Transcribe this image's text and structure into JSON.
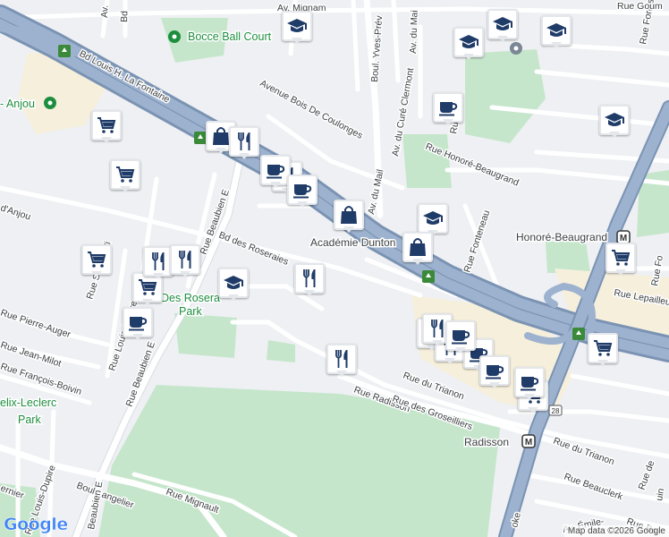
{
  "labels": {
    "roads": [
      {
        "id": "bd-louis-h-la-fontaine",
        "text": "Bd Louis H. La Fontaine"
      },
      {
        "id": "boul-yves-prevost",
        "text": "Boul. Yves-Prév"
      },
      {
        "id": "av-du-mail-1",
        "text": "Av. du Mail"
      },
      {
        "id": "av-du-mail-2",
        "text": "Av. du Mail"
      },
      {
        "id": "av-du-cure-clermont",
        "text": "Av. du Curé Clermont"
      },
      {
        "id": "avenue-bois-de-coulonges",
        "text": "Avenue Bois De Coulonges"
      },
      {
        "id": "bd-anjou",
        "text": "d'Anjou"
      },
      {
        "id": "rue-beaubien-e-1",
        "text": "Rue Beaubien E"
      },
      {
        "id": "rue-beaubien-e-2",
        "text": "Rue Beaubien E"
      },
      {
        "id": "bd-des-roseraies",
        "text": "Bd des Roseraies"
      },
      {
        "id": "rue-saint-zotique",
        "text": "Rue Saint-Zoti"
      },
      {
        "id": "rue-pierre-auger",
        "text": "Rue Pierre-Auger"
      },
      {
        "id": "rue-jean-milot",
        "text": "Rue Jean-Milot"
      },
      {
        "id": "rue-francois-boivin",
        "text": "Rue François-Boivin"
      },
      {
        "id": "rue-louis-dupire-1",
        "text": "Rue Louis-Dupire"
      },
      {
        "id": "rue-louis-dupire-2",
        "text": "Rue Louis-Dupire"
      },
      {
        "id": "boul-langelier",
        "text": "Boul Langelier"
      },
      {
        "id": "rue-mignault",
        "text": "Rue Mignault"
      },
      {
        "id": "rue-radisson",
        "text": "Rue Radisson"
      },
      {
        "id": "rue-des-groseilliers",
        "text": "Rue des Groseilliers"
      },
      {
        "id": "rue-du-trianon-1",
        "text": "Rue du Trianon"
      },
      {
        "id": "rue-du-trianon-2",
        "text": "Rue du Trianon"
      },
      {
        "id": "rue-honore-beaugrand",
        "text": "Rue Honoré-Beaugrand"
      },
      {
        "id": "rue-fonteneau",
        "text": "Rue Fonteneau"
      },
      {
        "id": "rue-lepailleur",
        "text": "Rue Lepailleur"
      },
      {
        "id": "rue-beauclerk",
        "text": "Rue Beauclerk"
      },
      {
        "id": "av-emile",
        "text": "Av. Émile-"
      },
      {
        "id": "rue-forbisher",
        "text": "Rue Forbis"
      },
      {
        "id": "rue-de",
        "text": "Rue de"
      },
      {
        "id": "rue-gouin",
        "text": "Rue Goum"
      },
      {
        "id": "av-le-mail-top",
        "text": "Av. du Mai"
      },
      {
        "id": "av-mignam",
        "text": "Av. Mignam"
      },
      {
        "id": "rue-fo",
        "text": "Rue Fo"
      },
      {
        "id": "route-25",
        "text": "25"
      },
      {
        "id": "route-28",
        "text": "28"
      },
      {
        "id": "rue-mur-1",
        "text": "Rue"
      },
      {
        "id": "rue-w-1",
        "text": "Rue"
      },
      {
        "id": "uin",
        "text": "uin"
      },
      {
        "id": "rue-bois",
        "text": "Rue Bo"
      },
      {
        "id": "loke",
        "text": "oke"
      },
      {
        "id": "beaubien-e-sw",
        "text": "Beaubien E"
      },
      {
        "id": "dupire-sw",
        "text": "Rue Louis-Dupire"
      },
      {
        "id": "ernier",
        "text": "ernier"
      },
      {
        "id": "av-top",
        "text": "Av."
      },
      {
        "id": "bd-top",
        "text": "Bd"
      }
    ],
    "places": [
      {
        "id": "bocce-ball-court",
        "text": "Bocce Ball Court"
      },
      {
        "id": "anjou",
        "text": "- Anjou"
      },
      {
        "id": "academie-dunton",
        "text": "Académie Dunton"
      },
      {
        "id": "des-roseraies-park-1",
        "text": "Des Rosera"
      },
      {
        "id": "des-roseraies-park-2",
        "text": "Park"
      },
      {
        "id": "felix-leclerc-park-1",
        "text": "elix-Leclerc"
      },
      {
        "id": "felix-leclerc-park-2",
        "text": "Park"
      },
      {
        "id": "honore-beaugrand-station",
        "text": "Honoré-Beaugrand"
      },
      {
        "id": "radisson-station",
        "text": "Radisson"
      }
    ]
  },
  "metro_badge": "M",
  "attribution": "Map data ©2026 Google",
  "google_logo": "Google",
  "colors": {
    "highway": "#8fa6c4",
    "highway_casing": "#7b93b3",
    "park": "#c6e6cc",
    "park_label": "#1e8e3e",
    "marker_icon": "#1f3b68",
    "school_icon": "#1f3b68"
  },
  "markers": [
    {
      "type": "school",
      "icon": "graduation-cap-icon"
    },
    {
      "type": "school",
      "icon": "graduation-cap-icon"
    },
    {
      "type": "school",
      "icon": "graduation-cap-icon"
    },
    {
      "type": "school",
      "icon": "graduation-cap-icon"
    },
    {
      "type": "school",
      "icon": "graduation-cap-icon"
    },
    {
      "type": "school",
      "icon": "graduation-cap-icon"
    },
    {
      "type": "school",
      "icon": "graduation-cap-icon"
    },
    {
      "type": "grocery",
      "icon": "shopping-cart-icon"
    },
    {
      "type": "grocery",
      "icon": "shopping-cart-icon"
    },
    {
      "type": "grocery",
      "icon": "shopping-cart-icon"
    },
    {
      "type": "grocery",
      "icon": "shopping-cart-icon"
    },
    {
      "type": "grocery",
      "icon": "shopping-cart-icon"
    },
    {
      "type": "grocery",
      "icon": "shopping-cart-icon"
    },
    {
      "type": "grocery",
      "icon": "shopping-cart-icon"
    },
    {
      "type": "shop",
      "icon": "shopping-bag-icon"
    },
    {
      "type": "shop",
      "icon": "shopping-bag-icon"
    },
    {
      "type": "shop",
      "icon": "shopping-bag-icon"
    },
    {
      "type": "restaurant",
      "icon": "fork-knife-icon"
    },
    {
      "type": "restaurant",
      "icon": "fork-knife-icon"
    },
    {
      "type": "restaurant",
      "icon": "fork-knife-icon"
    },
    {
      "type": "restaurant",
      "icon": "fork-knife-icon"
    },
    {
      "type": "restaurant",
      "icon": "fork-knife-icon"
    },
    {
      "type": "restaurant",
      "icon": "fork-knife-icon"
    },
    {
      "type": "restaurant",
      "icon": "fork-knife-icon"
    },
    {
      "type": "restaurant",
      "icon": "fork-knife-icon"
    },
    {
      "type": "restaurant",
      "icon": "fork-knife-icon"
    },
    {
      "type": "cafe",
      "icon": "coffee-cup-icon"
    },
    {
      "type": "cafe",
      "icon": "coffee-cup-icon"
    },
    {
      "type": "cafe",
      "icon": "coffee-cup-icon"
    },
    {
      "type": "cafe",
      "icon": "coffee-cup-icon"
    },
    {
      "type": "cafe",
      "icon": "coffee-cup-icon"
    },
    {
      "type": "cafe",
      "icon": "coffee-cup-icon"
    },
    {
      "type": "cafe",
      "icon": "coffee-cup-icon"
    },
    {
      "type": "cafe",
      "icon": "coffee-cup-icon"
    }
  ]
}
